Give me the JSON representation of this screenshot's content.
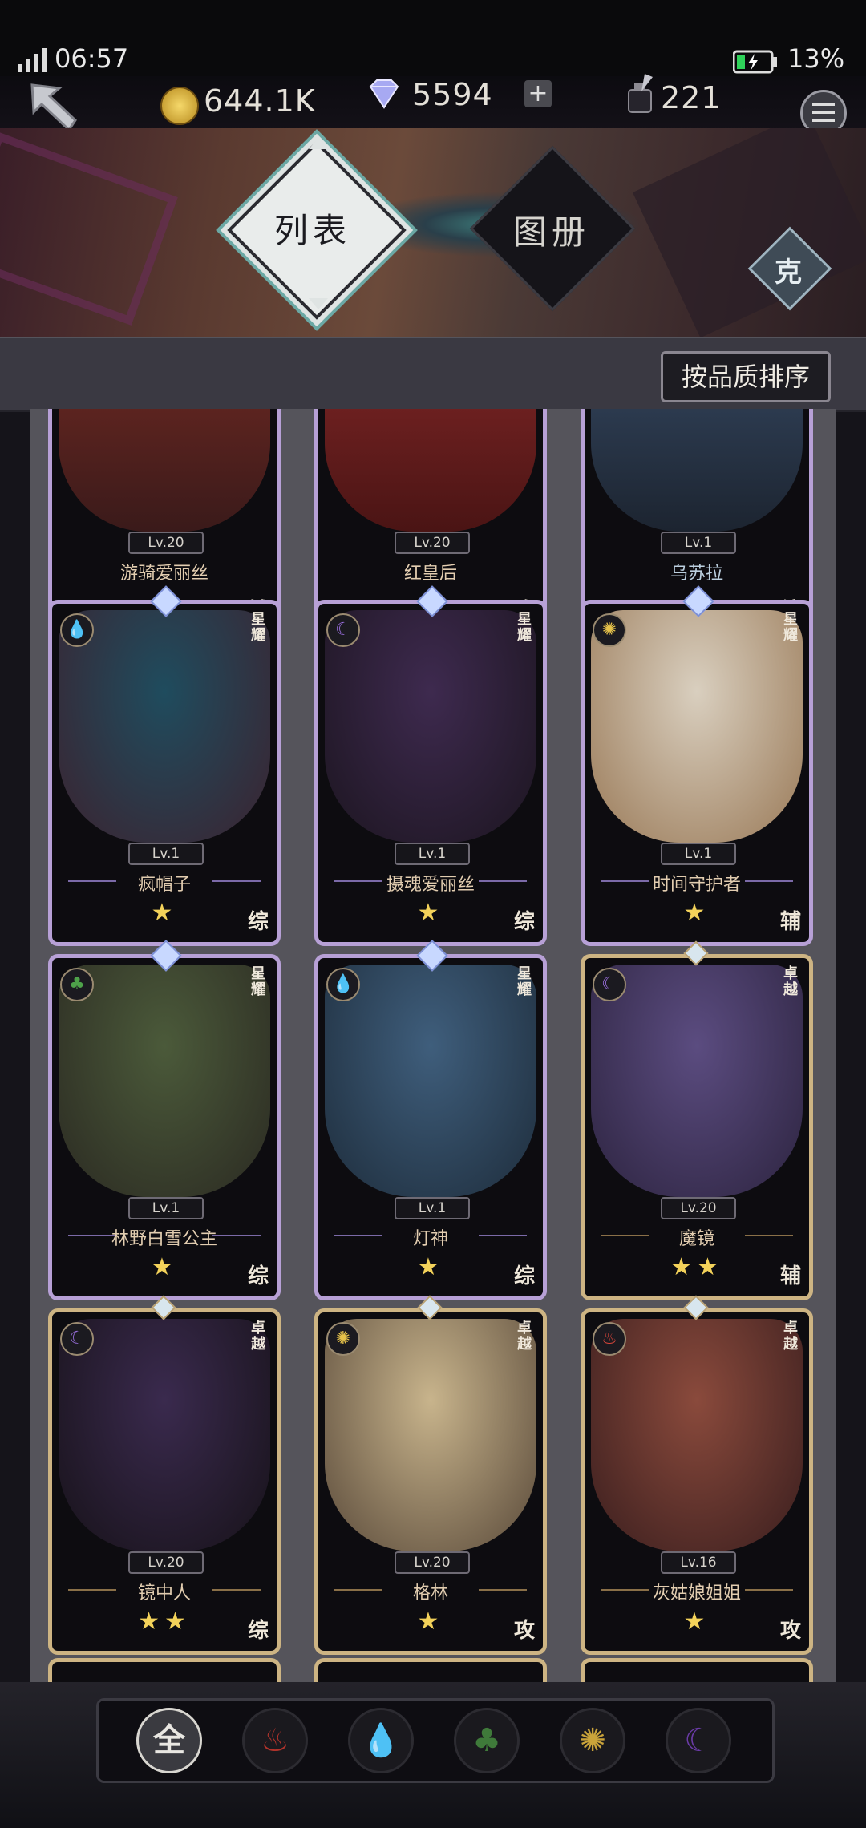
{
  "status_bar": {
    "time": "06:57",
    "battery": "13%",
    "signal_icon": "signal-icon",
    "battery_icon": "battery-charging-icon"
  },
  "header": {
    "back_icon": "back-arrow-icon",
    "gold": "644.1K",
    "diamonds": "5594",
    "ink": "221",
    "plus_icon": "plus-icon",
    "menu_icon": "menu-icon"
  },
  "tabs": [
    {
      "label": "列表",
      "selected": true
    },
    {
      "label": "图册",
      "selected": false
    }
  ],
  "counter_button": "克",
  "sort_button": "按品质排序",
  "cards_top_row": [
    {
      "level": "Lv.20",
      "name": "游骑爱丽丝",
      "stars": "★",
      "role": "辅"
    },
    {
      "level": "Lv.20",
      "name": "红皇后",
      "stars": "★",
      "role": "攻"
    },
    {
      "level": "Lv.1",
      "name": "乌苏拉",
      "stars": "★",
      "role": "综"
    }
  ],
  "cards": [
    {
      "level": "Lv.1",
      "name": "疯帽子",
      "stars": "★",
      "role": "综",
      "rank": "星耀",
      "element": "water",
      "element_icon": "water-icon",
      "tier": "star",
      "art_colors": [
        "#1f4c5e",
        "#3b2330"
      ]
    },
    {
      "level": "Lv.1",
      "name": "摄魂爱丽丝",
      "stars": "★",
      "role": "综",
      "rank": "星耀",
      "element": "dark",
      "element_icon": "moon-icon",
      "tier": "star",
      "art_colors": [
        "#3e2a4f",
        "#1c1520"
      ]
    },
    {
      "level": "Lv.1",
      "name": "时间守护者",
      "stars": "★",
      "role": "辅",
      "rank": "星耀",
      "element": "light",
      "element_icon": "sun-icon",
      "tier": "star",
      "art_colors": [
        "#d9cfbf",
        "#9a7a58"
      ]
    },
    {
      "level": "Lv.1",
      "name": "林野白雪公主",
      "stars": "★",
      "role": "综",
      "rank": "星耀",
      "element": "wood",
      "element_icon": "leaf-icon",
      "tier": "star",
      "art_colors": [
        "#4b5a3a",
        "#2b2a22"
      ]
    },
    {
      "level": "Lv.1",
      "name": "灯神",
      "stars": "★",
      "role": "综",
      "rank": "星耀",
      "element": "water",
      "element_icon": "water-icon",
      "tier": "star",
      "art_colors": [
        "#3f5e7c",
        "#1e2d3c"
      ]
    },
    {
      "level": "Lv.20",
      "name": "魔镜",
      "stars": "★★",
      "role": "辅",
      "rank": "卓越",
      "element": "dark",
      "element_icon": "moon-icon",
      "tier": "elite",
      "art_colors": [
        "#5b4c80",
        "#2d2440"
      ]
    },
    {
      "level": "Lv.20",
      "name": "镜中人",
      "stars": "★★",
      "role": "综",
      "rank": "卓越",
      "element": "dark",
      "element_icon": "moon-icon",
      "tier": "elite",
      "art_colors": [
        "#3a2a4e",
        "#171219"
      ]
    },
    {
      "level": "Lv.20",
      "name": "格林",
      "stars": "★",
      "role": "攻",
      "rank": "卓越",
      "element": "light",
      "element_icon": "sun-icon",
      "tier": "elite",
      "art_colors": [
        "#c8b48c",
        "#5a4a3a"
      ]
    },
    {
      "level": "Lv.16",
      "name": "灰姑娘姐姐",
      "stars": "★",
      "role": "攻",
      "rank": "卓越",
      "element": "fire",
      "element_icon": "fire-icon",
      "tier": "elite",
      "art_colors": [
        "#8a4a3c",
        "#3a1e1e"
      ]
    }
  ],
  "filters": [
    {
      "label": "全",
      "icon": "all-icon",
      "color": "#c9c7c2",
      "selected": true
    },
    {
      "label": "",
      "icon": "fire-icon",
      "color": "#b2332b"
    },
    {
      "label": "",
      "icon": "water-icon",
      "color": "#2b6fb2"
    },
    {
      "label": "",
      "icon": "leaf-icon",
      "color": "#3f7a3a"
    },
    {
      "label": "",
      "icon": "sun-icon",
      "color": "#c9a33a"
    },
    {
      "label": "",
      "icon": "moon-icon",
      "color": "#6b3ba8"
    }
  ]
}
